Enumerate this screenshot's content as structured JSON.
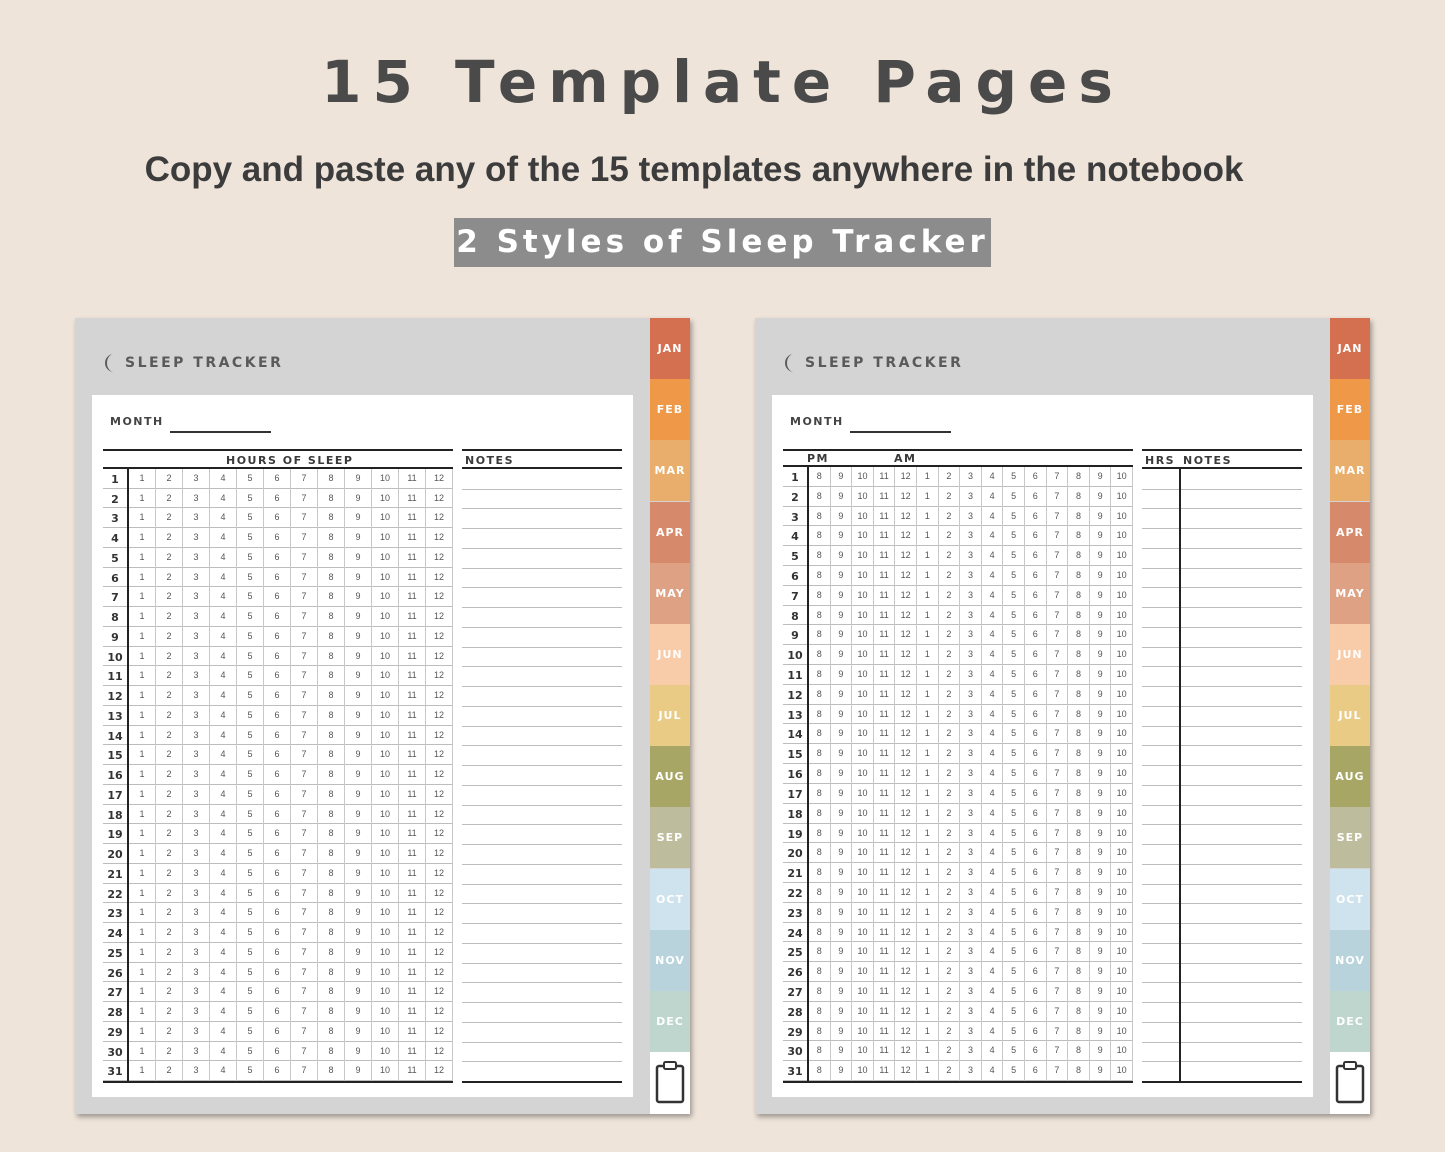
{
  "heading": {
    "title": "15 Template Pages",
    "subtitle": "Copy and paste any of the 15 templates anywhere in the notebook",
    "badge": "2 Styles of Sleep Tracker"
  },
  "tracker": {
    "title": "SLEEP TRACKER",
    "month_label": "MONTH",
    "days": [
      1,
      2,
      3,
      4,
      5,
      6,
      7,
      8,
      9,
      10,
      11,
      12,
      13,
      14,
      15,
      16,
      17,
      18,
      19,
      20,
      21,
      22,
      23,
      24,
      25,
      26,
      27,
      28,
      29,
      30,
      31
    ]
  },
  "style1": {
    "header_hours": "HOURS OF SLEEP",
    "header_notes": "NOTES",
    "hours": [
      "1",
      "2",
      "3",
      "4",
      "5",
      "6",
      "7",
      "8",
      "9",
      "10",
      "11",
      "12"
    ]
  },
  "style2": {
    "header_pm": "PM",
    "header_am": "AM",
    "header_hrs": "HRS",
    "header_notes": "NOTES",
    "hours": [
      "8",
      "9",
      "10",
      "11",
      "12",
      "1",
      "2",
      "3",
      "4",
      "5",
      "6",
      "7",
      "8",
      "9",
      "10"
    ]
  },
  "months": [
    {
      "label": "JAN",
      "color": "#d4704f"
    },
    {
      "label": "FEB",
      "color": "#ee9848"
    },
    {
      "label": "MAR",
      "color": "#e9ae6c"
    },
    {
      "label": "APR",
      "color": "#d78a6b"
    },
    {
      "label": "MAY",
      "color": "#dea183"
    },
    {
      "label": "JUN",
      "color": "#f8cba9"
    },
    {
      "label": "JUL",
      "color": "#e9cb86"
    },
    {
      "label": "AUG",
      "color": "#a7a665"
    },
    {
      "label": "SEP",
      "color": "#bdbd9d"
    },
    {
      "label": "OCT",
      "color": "#cfe3ee"
    },
    {
      "label": "NOV",
      "color": "#b8d3db"
    },
    {
      "label": "DEC",
      "color": "#bed6ce"
    }
  ],
  "icons": {
    "moon": "moon-icon",
    "clipboard": "clipboard-icon"
  }
}
